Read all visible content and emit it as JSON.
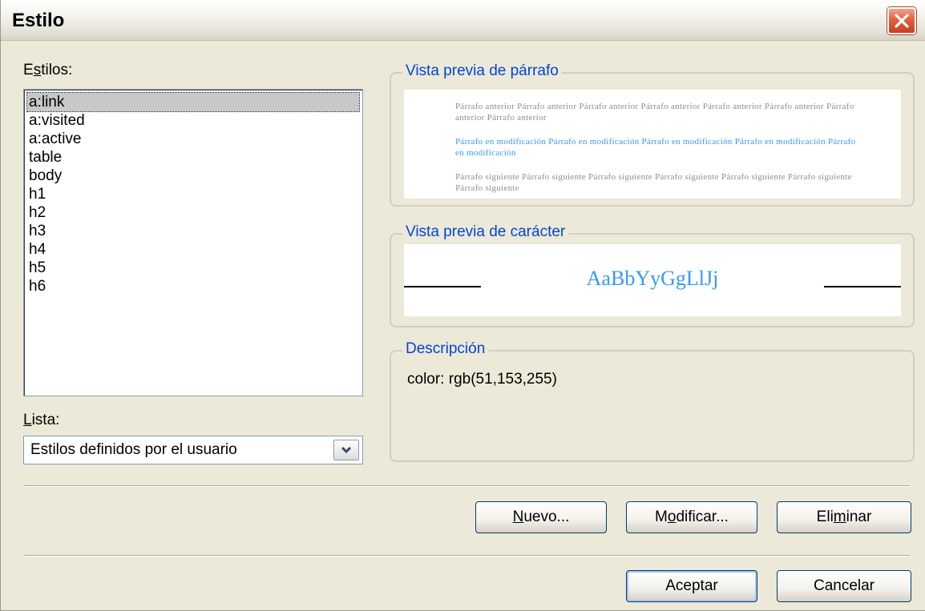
{
  "window": {
    "title": "Estilo"
  },
  "styles_label": "Estilos:",
  "styles_list": [
    "a:link",
    "a:visited",
    "a:active",
    "table",
    "body",
    "h1",
    "h2",
    "h3",
    "h4",
    "h5",
    "h6"
  ],
  "selected_index": 0,
  "list_label": "Lista:",
  "list_combo": {
    "value": "Estilos definidos por el usuario"
  },
  "paragraph_preview": {
    "legend": "Vista previa de párrafo",
    "previous": "Párrafo anterior Párrafo anterior Párrafo anterior Párrafo anterior Párrafo anterior Párrafo anterior Párrafo anterior Párrafo anterior",
    "modified": "Párrafo en modificación Párrafo en modificación Párrafo en modificación Párrafo en modificación Párrafo en modificación",
    "following": "Párrafo siguiente Párrafo siguiente Párrafo siguiente Párrafo siguiente Párrafo siguiente Párrafo siguiente Párrafo siguiente"
  },
  "character_preview": {
    "legend": "Vista previa de carácter",
    "sample": "AaBbYyGgLlJj"
  },
  "description": {
    "legend": "Descripción",
    "text": "color: rgb(51,153,255)"
  },
  "buttons": {
    "new": "Nuevo...",
    "modify": "Modificar...",
    "delete": "Eliminar",
    "ok": "Aceptar",
    "cancel": "Cancelar"
  },
  "colors": {
    "preview_blue": "#3399ff",
    "legend_blue": "#0046d5",
    "dialog_bg": "#ece9d8"
  },
  "icons": {
    "close": "close-icon",
    "dropdown": "chevron-down-icon"
  }
}
